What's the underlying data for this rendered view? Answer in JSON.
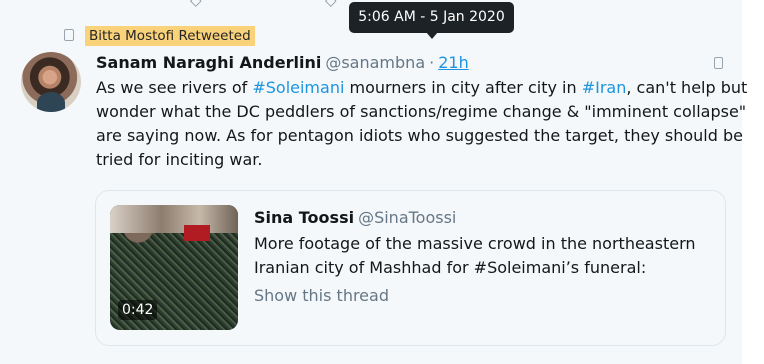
{
  "tooltip": {
    "timestamp": "5:06 AM - 5 Jan 2020"
  },
  "retweet": {
    "label": "Bitta Mostofi Retweeted"
  },
  "tweet": {
    "author_name": "Sanam Naraghi Anderlini",
    "author_handle": "@sanambna",
    "separator": "·",
    "time_ago": "21h",
    "lines": [
      {
        "t1": "As we see rivers of ",
        "h1": "#Soleimani",
        "t2": " mourners in city after city in ",
        "h2": "#Iran",
        "t3": ", can't help but"
      },
      "wonder what the DC peddlers of sanctions/regime change & \"imminent collapse\"",
      "are saying now. As for pentagon idiots who suggested the target, they should be",
      "tried for inciting war."
    ]
  },
  "quoted_tweet": {
    "author_name": "Sina Toossi",
    "author_handle": "@SinaToossi",
    "lines": [
      "More footage of the massive crowd in the northeastern",
      "Iranian city of Mashhad for #Soleimani’s funeral:"
    ],
    "show_thread": "Show this thread",
    "video_duration": "0:42"
  },
  "icons": {
    "retweet": "retweet-icon",
    "more": "more-options-icon",
    "avatar": "avatar"
  },
  "colors": {
    "link": "#1b95e0",
    "tooltip_bg": "#1d2226",
    "highlight": "#f9d27a",
    "muted": "#657786",
    "background": "#f5f8fa"
  }
}
